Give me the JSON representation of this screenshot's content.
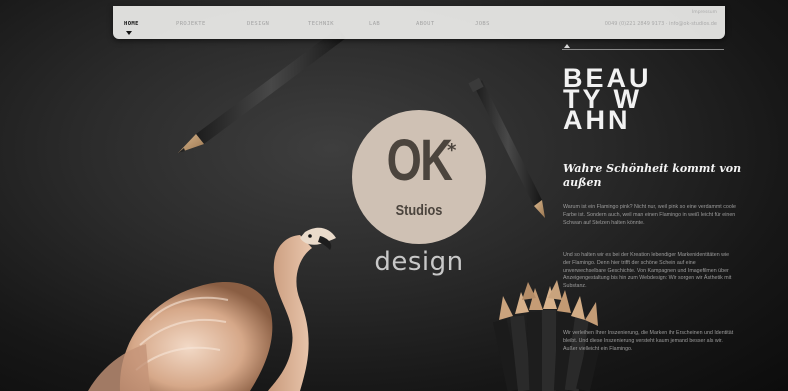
{
  "nav": {
    "items": [
      "HOME",
      "PROJEKTE",
      "DESIGN",
      "TECHNIK",
      "LAB",
      "ABOUT",
      "JOBS"
    ],
    "active": "HOME",
    "impressum": "Impressum",
    "contact": "0049 (0)221 2849 9173 · info@ok-studios.de"
  },
  "logo": {
    "mark": "OK",
    "star": "*",
    "studios": "Studios",
    "design": "design"
  },
  "article": {
    "headline": [
      "BEAU",
      "TY W",
      "AHN"
    ],
    "subhead": "Wahre Schönheit kommt von außen",
    "paragraphs": [
      "Warum ist ein Flamingo pink? Nicht nur, weil pink so eine verdammt coole Farbe ist. Sondern auch, weil man einen Flamingo in weiß leicht für einen Schwan auf Stelzen halten könnte.",
      "Und so halten wir es bei der Kreation lebendiger Markenidentitäten wie der Flamingo. Denn hier trifft der schöne Schein auf eine unverwechselbare Geschichte. Von Kampagnen und Imagefilmen über Anzeigengestaltung bis hin zum Webdesign: Wir sorgen wir Ästhetik mit Substanz.",
      "Wir verleihen Ihrer Inszenierung, die Marken ihr Erscheinen und Identität bleibt. Und diese Inszenierung versteht kaum jemand besser als wir. Außer vielleicht ein Flamingo."
    ]
  },
  "colors": {
    "logo_circle": "#cfc1b4",
    "logo_text": "#4b443d",
    "nav_bg": "#ececE9",
    "background": "#2b2b2b"
  }
}
